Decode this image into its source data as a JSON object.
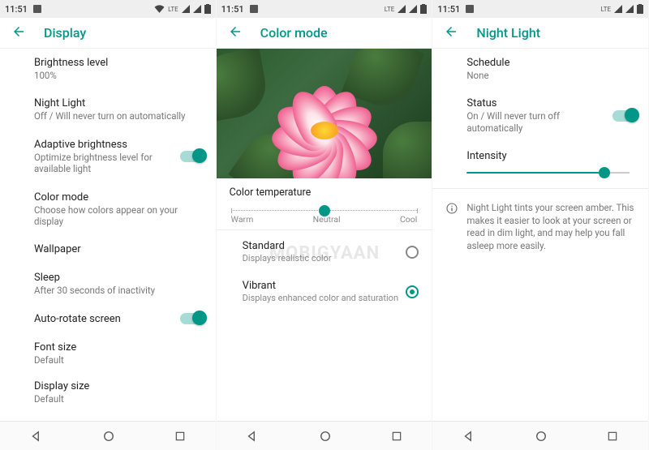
{
  "accent": "#009688",
  "watermark": "MOBIGYAAN",
  "status": {
    "time": "11:51",
    "lte": "LTE"
  },
  "nav": {
    "back": "back-icon",
    "home": "home-icon",
    "recents": "recents-icon"
  },
  "screens": {
    "display": {
      "title": "Display",
      "items": [
        {
          "label": "Brightness level",
          "sub": "100%"
        },
        {
          "label": "Night Light",
          "sub": "Off / Will never turn on automatically"
        },
        {
          "label": "Adaptive brightness",
          "sub": "Optimize brightness level for available light",
          "toggle": true
        },
        {
          "label": "Color mode",
          "sub": "Choose how colors appear on your display"
        },
        {
          "label": "Wallpaper"
        },
        {
          "label": "Sleep",
          "sub": "After 30 seconds of inactivity"
        },
        {
          "label": "Auto-rotate screen",
          "toggle": true
        },
        {
          "label": "Font size",
          "sub": "Default"
        },
        {
          "label": "Display size",
          "sub": "Default"
        }
      ]
    },
    "color_mode": {
      "title": "Color mode",
      "temperature_label": "Color temperature",
      "temp_labels": {
        "warm": "Warm",
        "neutral": "Neutral",
        "cool": "Cool"
      },
      "temperature_value": 50,
      "modes": [
        {
          "label": "Standard",
          "sub": "Displays realistic color",
          "selected": false
        },
        {
          "label": "Vibrant",
          "sub": "Displays enhanced color and saturation",
          "selected": true
        }
      ]
    },
    "night_light": {
      "title": "Night Light",
      "schedule": {
        "label": "Schedule",
        "value": "None"
      },
      "status": {
        "label": "Status",
        "value": "On / Will never turn off automatically",
        "on": true
      },
      "intensity": {
        "label": "Intensity",
        "value_pct": 88
      },
      "info": "Night Light tints your screen amber. This makes it easier to look at your screen or read in dim light, and may help you fall asleep more easily."
    }
  }
}
